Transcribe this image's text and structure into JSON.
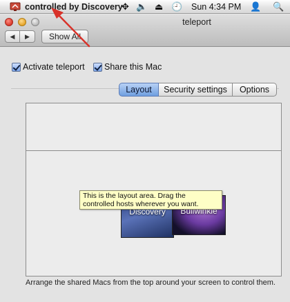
{
  "menubar": {
    "app_icon": "screen-sharing-app-icon",
    "app_name": "controlled by Discovery",
    "status_icons": [
      "move-arrows-icon",
      "volume-icon",
      "eject-icon",
      "time-machine-icon"
    ],
    "clock": "Sun 4:34 PM",
    "user_icon": "user-icon",
    "spotlight_icon": "spotlight-search-icon"
  },
  "window": {
    "title": "teleport",
    "show_all_label": "Show All",
    "nav": {
      "back_icon": "back-arrow-icon",
      "forward_icon": "forward-arrow-icon"
    }
  },
  "options": {
    "activate_label": "Activate teleport",
    "activate_checked": true,
    "share_label": "Share this Mac",
    "share_checked": true
  },
  "tabs": [
    {
      "label": "Layout",
      "selected": true
    },
    {
      "label": "Security settings",
      "selected": false
    },
    {
      "label": "Options",
      "selected": false
    }
  ],
  "layout_area": {
    "screens": [
      {
        "label": "Discov­ery"
      },
      {
        "label": "Bullwinkle"
      }
    ],
    "tooltip": "This is the layout area. Drag the controlled hosts wherever you want."
  },
  "footer_text": "Arrange the shared Macs from the top around your screen to control them.",
  "colors": {
    "annotation_arrow": "#d8322a",
    "selected_tab": "#6f9fe0",
    "tooltip_bg": "#fefec6"
  }
}
